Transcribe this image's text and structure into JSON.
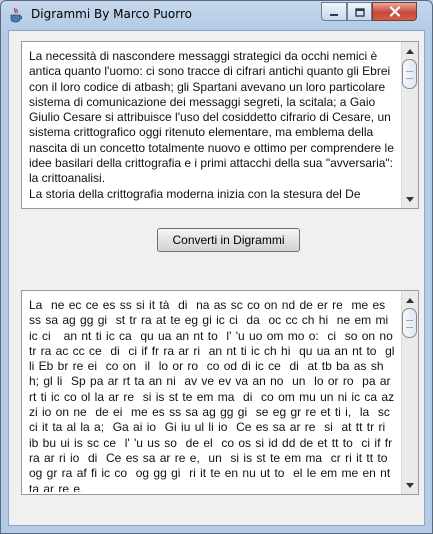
{
  "window": {
    "title": "Digrammi By Marco Puorro",
    "icon": "java-cup-icon",
    "controls": {
      "minimize": "minimize-icon",
      "maximize": "maximize-icon",
      "close": "close-icon"
    }
  },
  "input_panel": {
    "text": "La necessità di nascondere messaggi strategici da occhi nemici è antica quanto l'uomo: ci sono tracce di cifrari antichi quanto gli Ebrei con il loro codice di atbash; gli Spartani avevano un loro particolare sistema di comunicazione dei messaggi segreti, la scitala; a Gaio Giulio Cesare si attribuisce l'uso del cosiddetto cifrario di Cesare, un sistema crittografico oggi ritenuto elementare, ma emblema della nascita di un concetto totalmente nuovo e ottimo per comprendere le idee basilari della crittografia e i primi attacchi della sua \"avversaria\": la crittoanalisi.\nLa storia della crittografia moderna inizia con la stesura del De"
  },
  "convert_button": {
    "label": "Converti in Digrammi"
  },
  "output_panel": {
    "text": "La  ne ec ce es ss si it tà  di  na as sc co on nd de er re  me es ss sa ag gg gi  st tr ra at te eg gi ic ci  da  oc cc ch hi  ne em mi ic ci   an nt ti ic ca  qu ua an nt to  l' 'u uo om mo o:  ci  so on no  tr ra ac cc ce  di  ci if fr ra ar ri  an nt ti ic ch hi  qu ua an nt to  gl li Eb br re ei  co on  il  lo or ro  co od di ic ce  di  at tb ba as sh h; gl li  Sp pa ar rt ta an ni  av ve ev va an no  un  lo or ro  pa ar rt ti ic co ol la ar re  si is st te em ma  di  co om mu un ni ic ca az zi io on ne  de ei  me es ss sa ag gg gi  se eg gr re et ti i,  la  sc ci it ta al la a;  Ga ai io  Gi iu ul li io  Ce es sa ar re  si  at tt tr ri ib bu ui is sc ce  l' 'u us so  de el  co os si id dd de et tt to  ci if fr ra ar ri io  di  Ce es sa ar re e,  un  si is st te em ma  cr ri it tt to og gr ra af fi ic co  og gg gi  ri it te en nu ut to  el le em me en nt ta ar re e,"
  }
}
